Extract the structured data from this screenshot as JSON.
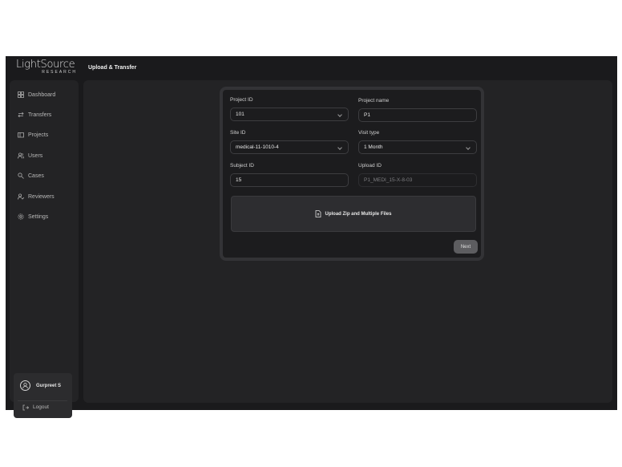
{
  "brand": {
    "name": "LightSource",
    "subtitle": "RESEARCH"
  },
  "sidebar": {
    "items": [
      {
        "label": "Dashboard",
        "icon": "dashboard-icon"
      },
      {
        "label": "Transfers",
        "icon": "transfers-icon"
      },
      {
        "label": "Projects",
        "icon": "projects-icon"
      },
      {
        "label": "Users",
        "icon": "users-icon"
      },
      {
        "label": "Cases",
        "icon": "cases-icon"
      },
      {
        "label": "Reviewers",
        "icon": "reviewers-icon"
      },
      {
        "label": "Settings",
        "icon": "settings-icon"
      }
    ],
    "user": {
      "name": "Gurpreet S",
      "icon": "user-avatar-icon"
    },
    "logout_label": "Logout"
  },
  "header": {
    "title": "Upload & Transfer"
  },
  "form": {
    "project_id": {
      "label": "Project ID",
      "value": "101"
    },
    "project_name": {
      "label": "Project name",
      "value": "P1"
    },
    "site_id": {
      "label": "Site ID",
      "value": "medical-11-1010-4"
    },
    "visit_type": {
      "label": "Visit type",
      "value": "1 Month"
    },
    "subject_id": {
      "label": "Subject ID",
      "value": "15"
    },
    "upload_id": {
      "label": "Upload ID",
      "value": "P1_MEDI_15-X-8-03"
    },
    "upload_label": "Upload Zip and Multiple Files",
    "next_label": "Next"
  }
}
